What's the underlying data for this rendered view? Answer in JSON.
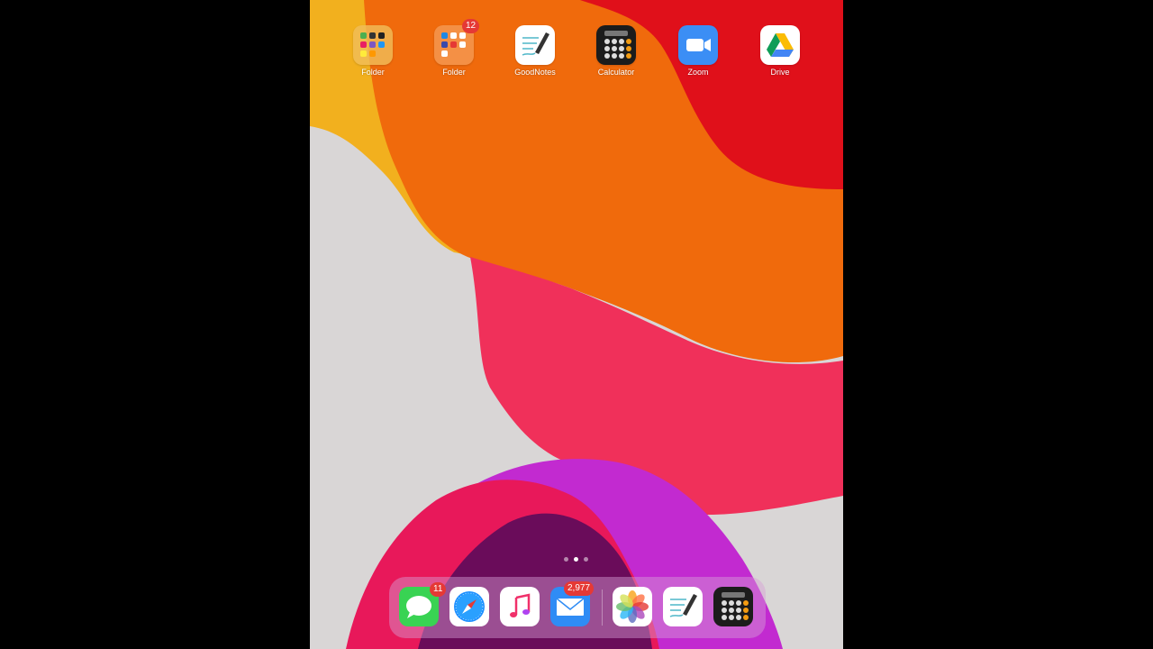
{
  "home_screen": {
    "apps": [
      {
        "name": "Folder",
        "icon": "folder-icon",
        "badge": ""
      },
      {
        "name": "Folder",
        "icon": "folder-icon",
        "badge": "12"
      },
      {
        "name": "GoodNotes",
        "icon": "goodnotes-icon",
        "badge": ""
      },
      {
        "name": "Calculator",
        "icon": "calculator-icon",
        "badge": ""
      },
      {
        "name": "Zoom",
        "icon": "zoom-icon",
        "badge": ""
      },
      {
        "name": "Drive",
        "icon": "google-drive-icon",
        "badge": ""
      }
    ],
    "page_indicator": {
      "pages": 3,
      "current": 2
    }
  },
  "dock": {
    "apps": [
      {
        "icon": "messages-icon",
        "badge": "11"
      },
      {
        "icon": "safari-icon",
        "badge": ""
      },
      {
        "icon": "music-icon",
        "badge": ""
      },
      {
        "icon": "mail-icon",
        "badge": "2,977"
      },
      {
        "icon": "photos-icon",
        "badge": ""
      },
      {
        "icon": "goodnotes-icon",
        "badge": ""
      },
      {
        "icon": "calculator-icon",
        "badge": ""
      }
    ]
  },
  "colors": {
    "wallpaper_gray": "#d9d6d6",
    "wallpaper_yellow": "#f2b01e",
    "wallpaper_orange": "#f06a0c",
    "wallpaper_red": "#e0101a",
    "wallpaper_pink": "#f0305a",
    "wallpaper_magenta": "#c22ad0",
    "badge_red": "#e53935"
  }
}
